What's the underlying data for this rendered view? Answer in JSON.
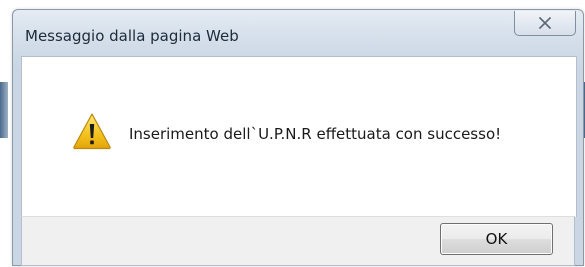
{
  "dialog": {
    "title": "Messaggio dalla pagina Web",
    "message": "Inserimento dell`U.P.N.R  effettuata con successo!",
    "ok_label": "OK",
    "icon": "warning-icon"
  },
  "colors": {
    "title_bar": "#d2dde9",
    "content_bg": "#ffffff",
    "footer_bg": "#f0f0f0",
    "warning_yellow": "#f4c21c"
  }
}
